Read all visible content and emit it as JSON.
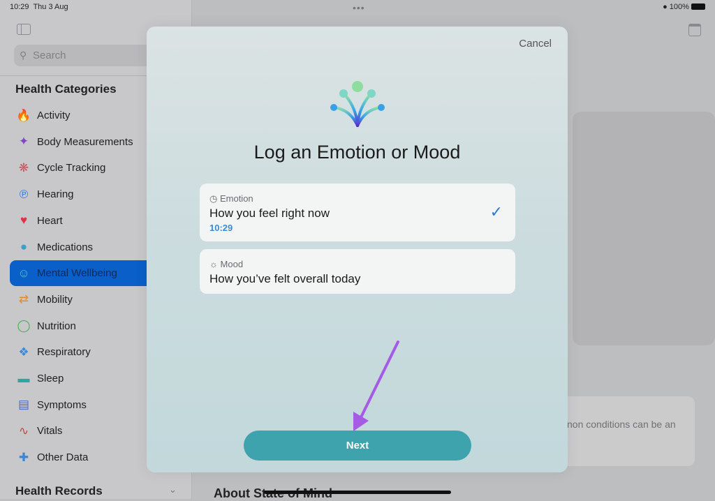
{
  "status_bar": {
    "time": "10:29",
    "date": "Thu 3 Aug",
    "battery": "100%"
  },
  "sidebar": {
    "search_placeholder": "Search",
    "section_title": "Health Categories",
    "items": [
      {
        "label": "Activity",
        "icon": "flame-icon",
        "color": "#e8521c"
      },
      {
        "label": "Body Measurements",
        "icon": "figure-icon",
        "color": "#8046c8"
      },
      {
        "label": "Cycle Tracking",
        "icon": "cycle-icon",
        "color": "#d0505e"
      },
      {
        "label": "Hearing",
        "icon": "ear-icon",
        "color": "#3a7ad6"
      },
      {
        "label": "Heart",
        "icon": "heart-icon",
        "color": "#e0304a"
      },
      {
        "label": "Medications",
        "icon": "pills-icon",
        "color": "#3aa2c8"
      },
      {
        "label": "Mental Wellbeing",
        "icon": "head-icon",
        "color": "#54c7d8",
        "selected": true
      },
      {
        "label": "Mobility",
        "icon": "arrows-icon",
        "color": "#e48a2a"
      },
      {
        "label": "Nutrition",
        "icon": "apple-icon",
        "color": "#42b050"
      },
      {
        "label": "Respiratory",
        "icon": "lungs-icon",
        "color": "#3c8ad8"
      },
      {
        "label": "Sleep",
        "icon": "bed-icon",
        "color": "#2aa8a0"
      },
      {
        "label": "Symptoms",
        "icon": "clipboard-icon",
        "color": "#4a6ab8"
      },
      {
        "label": "Vitals",
        "icon": "waveform-icon",
        "color": "#d04040"
      },
      {
        "label": "Other Data",
        "icon": "plus-icon",
        "color": "#3a86d8"
      }
    ],
    "records_title": "Health Records"
  },
  "background": {
    "card_text": "non conditions can be an",
    "about_title": "About State of Mind"
  },
  "modal": {
    "cancel": "Cancel",
    "title": "Log an Emotion or Mood",
    "options": [
      {
        "label": "Emotion",
        "main": "How you feel right now",
        "time": "10:29",
        "selected": true
      },
      {
        "label": "Mood",
        "main": "How you’ve felt overall today"
      }
    ],
    "next": "Next"
  },
  "annotation_color": "#a55be6"
}
